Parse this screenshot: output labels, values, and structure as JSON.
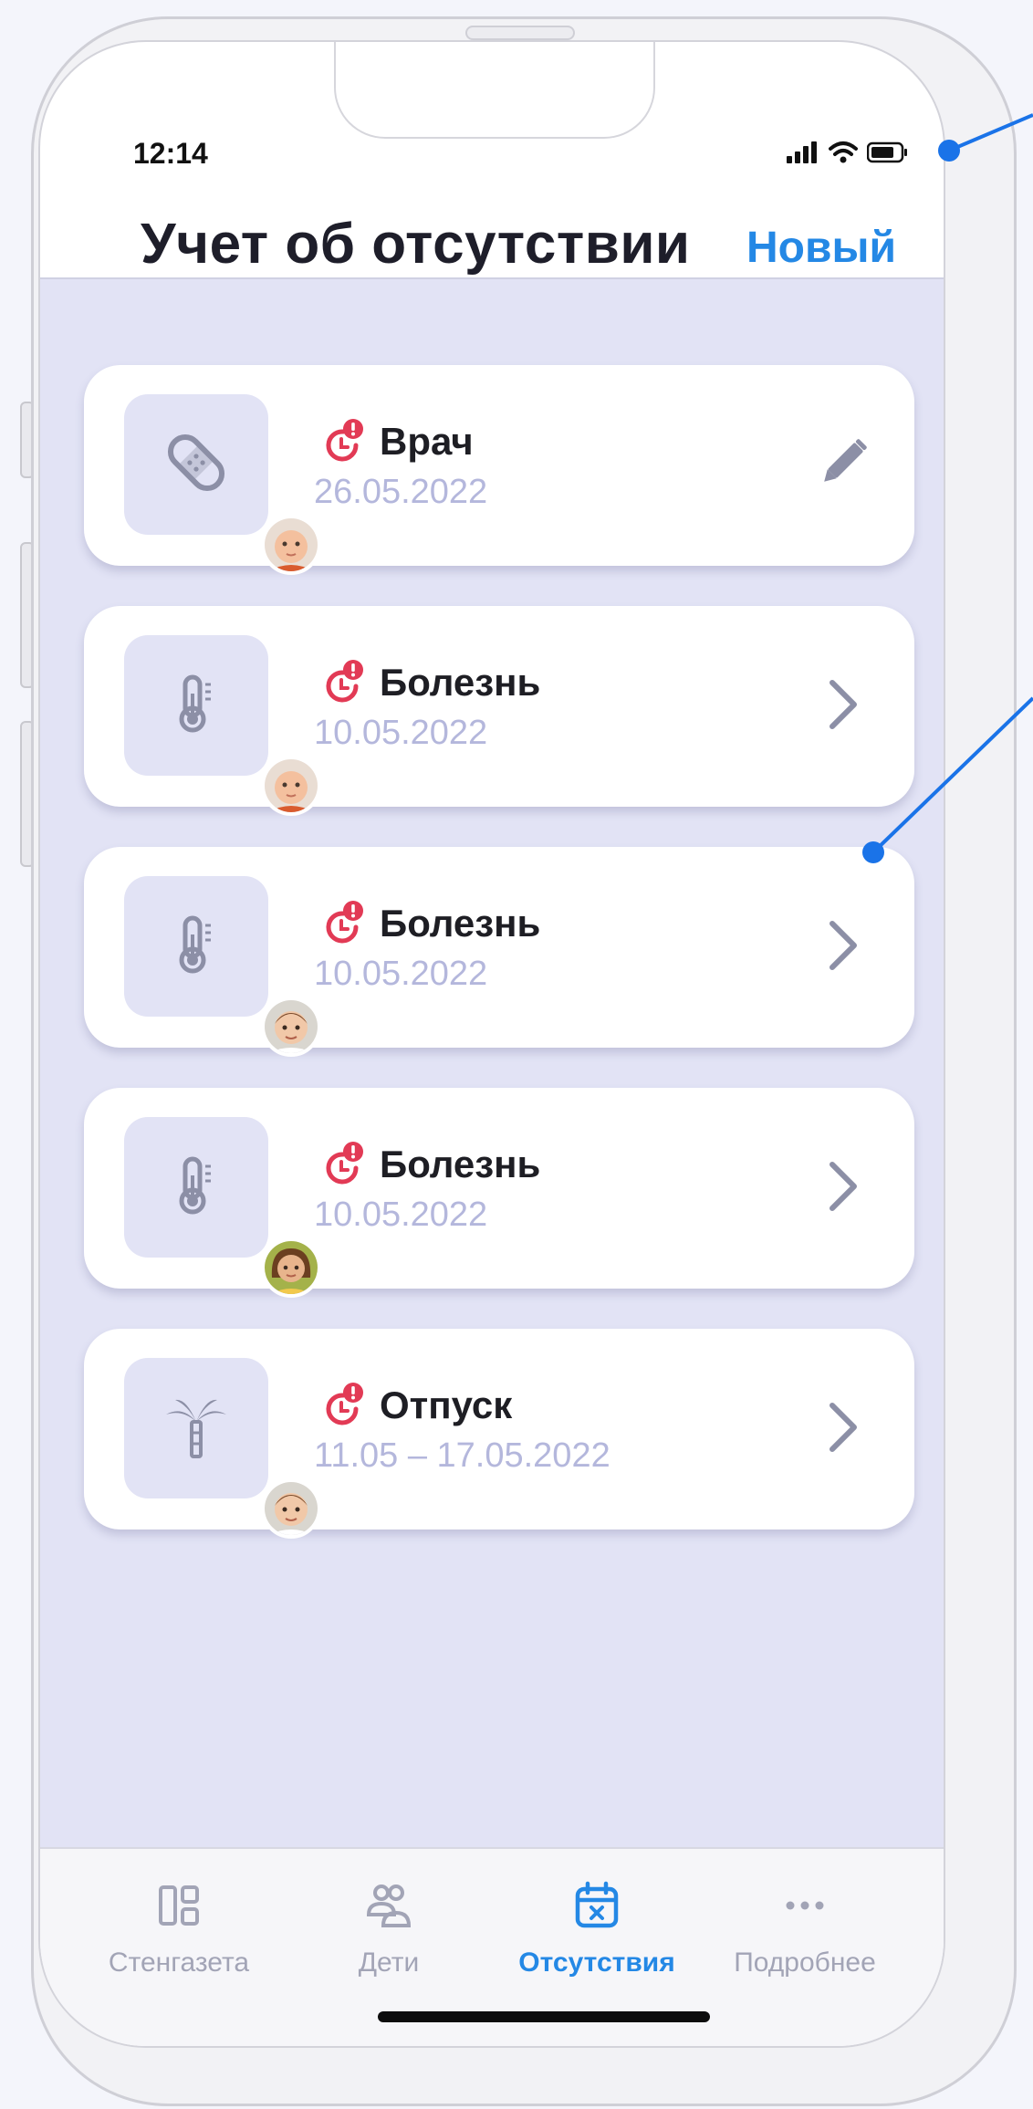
{
  "status_bar": {
    "time": "12:14"
  },
  "header": {
    "title": "Учет об отсутствии",
    "new_button": "Новый"
  },
  "absences": [
    {
      "type": "Врач",
      "date": "26.05.2022",
      "category_icon": "bandage-icon",
      "action_icon": "pencil-icon",
      "child": "child-1"
    },
    {
      "type": "Болезнь",
      "date": "10.05.2022",
      "category_icon": "thermometer-icon",
      "action_icon": "chevron-right-icon",
      "child": "child-1"
    },
    {
      "type": "Болезнь",
      "date": "10.05.2022",
      "category_icon": "thermometer-icon",
      "action_icon": "chevron-right-icon",
      "child": "child-2"
    },
    {
      "type": "Болезнь",
      "date": "10.05.2022",
      "category_icon": "thermometer-icon",
      "action_icon": "chevron-right-icon",
      "child": "child-3"
    },
    {
      "type": "Отпуск",
      "date": "11.05 – 17.05.2022",
      "category_icon": "palm-tree-icon",
      "action_icon": "chevron-right-icon",
      "child": "child-2"
    }
  ],
  "tabs": [
    {
      "label": "Стенгазета",
      "icon": "dashboard-icon",
      "active": false
    },
    {
      "label": "Дети",
      "icon": "children-icon",
      "active": false
    },
    {
      "label": "Отсутствия",
      "icon": "calendar-x-icon",
      "active": true
    },
    {
      "label": "Подробнее",
      "icon": "more-icon",
      "active": false
    }
  ],
  "colors": {
    "accent": "#2488e5",
    "alert": "#e23a55",
    "background": "#e2e3f5",
    "date_text": "#b4b7dc",
    "icon_gray": "#8c8fa6"
  }
}
